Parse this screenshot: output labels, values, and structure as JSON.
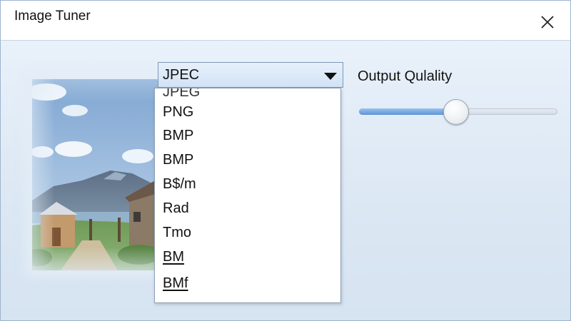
{
  "window": {
    "title": "Image Tuner",
    "close_icon": "close-icon"
  },
  "format_select": {
    "selected": "JPEC",
    "arrow_icon": "chevron-down-icon",
    "options": [
      "JPEG",
      "PNG",
      "BMP",
      "BMP",
      "B$/m",
      "Rad",
      "Tmo",
      "BM",
      "BMf"
    ]
  },
  "quality": {
    "label": "Output Qulality",
    "value_fraction": 0.49
  },
  "colors": {
    "accent": "#5d94d6",
    "background": "#dce8f4"
  }
}
